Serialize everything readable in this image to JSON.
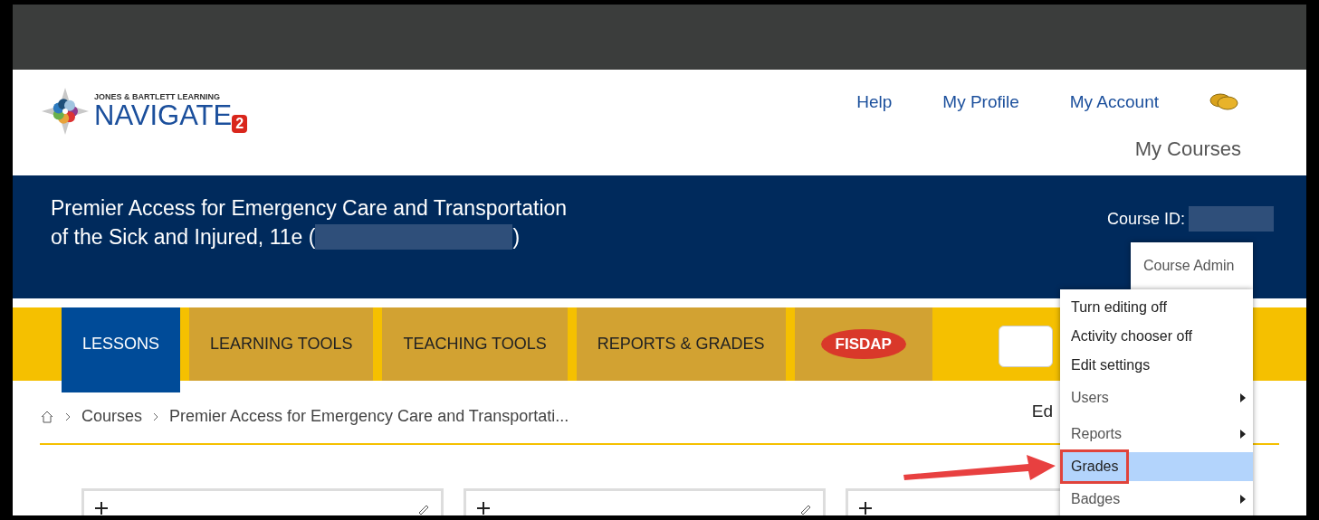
{
  "header": {
    "logo": {
      "publisher": "JONES & BARTLETT LEARNING",
      "product": "NAVIGATE",
      "badge": "2"
    },
    "links": [
      "Help",
      "My Profile",
      "My Account"
    ],
    "my_courses": "My Courses"
  },
  "banner": {
    "title_line_1": "Premier Access for Emergency Care and Transportation",
    "title_line_2": "of the Sick and Injured, 11e (",
    "title_close": ")",
    "course_id_label": "Course ID:"
  },
  "nav_tabs": [
    {
      "label": "LESSONS",
      "kind": "text",
      "selected": true
    },
    {
      "label": "LEARNING TOOLS",
      "kind": "text",
      "selected": false
    },
    {
      "label": "TEACHING TOOLS",
      "kind": "text",
      "selected": false
    },
    {
      "label": "REPORTS & GRADES",
      "kind": "text",
      "selected": false
    },
    {
      "label": "FISDAP",
      "kind": "logo",
      "selected": false
    }
  ],
  "breadcrumb": [
    "Courses",
    "Premier Access for Emergency Care and Transportati..."
  ],
  "edit_partial": "Ed",
  "course_admin": {
    "title": "Course Admin",
    "items": [
      {
        "label": "Turn editing off",
        "kind": "action",
        "selected": false
      },
      {
        "label": "Activity chooser off",
        "kind": "action",
        "selected": false
      },
      {
        "label": "Edit settings",
        "kind": "action",
        "selected": false
      },
      {
        "label": "Users",
        "kind": "submenu",
        "selected": false
      },
      {
        "label": "Reports",
        "kind": "submenu",
        "selected": false
      },
      {
        "label": "Grades",
        "kind": "action",
        "selected": true
      },
      {
        "label": "Badges",
        "kind": "submenu",
        "selected": false
      }
    ]
  },
  "cards": [
    {
      "kind": "full"
    },
    {
      "kind": "full"
    },
    {
      "kind": "covered"
    }
  ]
}
